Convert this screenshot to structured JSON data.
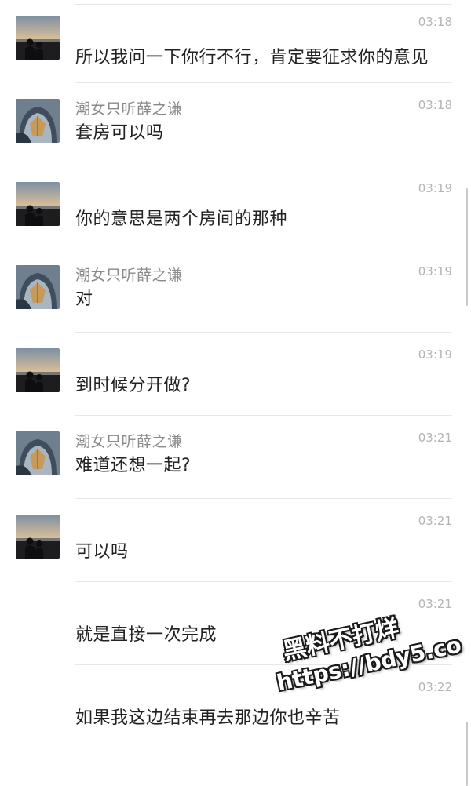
{
  "messages": [
    {
      "avatar": "sunset-silhouette-avatar",
      "sender": "",
      "time": "03:18",
      "text": "所以我问一下你行不行，肯定要征求你的意见"
    },
    {
      "avatar": "hooded-girl-avatar",
      "sender": "潮女只听薛之谦",
      "time": "03:18",
      "text": "套房可以吗"
    },
    {
      "avatar": "sunset-silhouette-avatar",
      "sender": "",
      "time": "03:19",
      "text": "你的意思是两个房间的那种"
    },
    {
      "avatar": "hooded-girl-avatar",
      "sender": "潮女只听薛之谦",
      "time": "03:19",
      "text": "对"
    },
    {
      "avatar": "sunset-silhouette-avatar",
      "sender": "",
      "time": "03:19",
      "text": "到时候分开做?"
    },
    {
      "avatar": "hooded-girl-avatar",
      "sender": "潮女只听薛之谦",
      "time": "03:21",
      "text": "难道还想一起?"
    },
    {
      "avatar": "sunset-silhouette-avatar",
      "sender": "",
      "time": "03:21",
      "text": "可以吗"
    },
    {
      "avatar": "",
      "sender": "",
      "time": "03:21",
      "text": "就是直接一次完成"
    },
    {
      "avatar": "",
      "sender": "",
      "time": "03:22",
      "text": "如果我这边结束再去那边你也辛苦"
    }
  ],
  "watermark": {
    "line1": "黑料不打烊",
    "line2": "https://bdy5.co"
  },
  "colors": {
    "sender": "#8a8a8a",
    "time": "#b4b4b4",
    "text": "#222222",
    "divider": "#e8e8e8"
  }
}
